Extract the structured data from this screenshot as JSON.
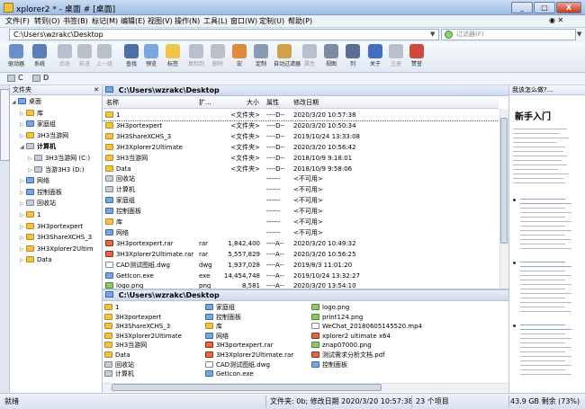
{
  "window": {
    "title": "xplorer2 * - 桌面 # [桌面]",
    "buttons": [
      "_",
      "□",
      "X"
    ]
  },
  "menu": [
    "文件(F)",
    "转到(O)",
    "书签(B)",
    "标记(M)",
    "编辑(E)",
    "视图(V)",
    "操作(N)",
    "工具(L)",
    "窗口(W)",
    "定制(U)",
    "帮助(P)"
  ],
  "menu_right": "◉  ✕",
  "address": {
    "value": "C:\\Users\\wzrakc\\Desktop",
    "filter_placeholder": "过滤器(F)"
  },
  "toolbar": [
    {
      "label": "驱动器",
      "icon": "drive-icon",
      "color": "#6b8fc9"
    },
    {
      "label": "系统",
      "icon": "system-icon",
      "color": "#5b7fb8"
    },
    {
      "label": "后退",
      "icon": "back-icon",
      "color": "#b8c0cc",
      "disabled": true
    },
    {
      "label": "前进",
      "icon": "forward-icon",
      "color": "#b8c0cc",
      "disabled": true
    },
    {
      "label": "上一级",
      "icon": "up-icon",
      "color": "#b8c0cc",
      "disabled": true
    },
    {
      "label": "查找",
      "icon": "binoculars-icon",
      "color": "#4d6fa8"
    },
    {
      "label": "预览",
      "icon": "preview-icon",
      "color": "#7aa7df"
    },
    {
      "label": "标签",
      "icon": "tab-icon",
      "color": "#f0c44a"
    },
    {
      "label": "复制到",
      "icon": "copy-icon",
      "color": "#b8c0cc",
      "disabled": true
    },
    {
      "label": "删除",
      "icon": "delete-icon",
      "color": "#b8c0cc",
      "disabled": true
    },
    {
      "label": "宏",
      "icon": "macro-icon",
      "color": "#e08a3c"
    },
    {
      "label": "定制",
      "icon": "customize-icon",
      "color": "#8a9ab0"
    },
    {
      "label": "自动过滤器",
      "icon": "filter-icon",
      "color": "#d2a24a"
    },
    {
      "label": "属性",
      "icon": "properties-icon",
      "color": "#b8c0cc",
      "disabled": true
    },
    {
      "label": "视图",
      "icon": "view-icon",
      "color": "#7a8aa0"
    },
    {
      "label": "列",
      "icon": "columns-icon",
      "color": "#5b6f94"
    },
    {
      "label": "关于",
      "icon": "help-icon",
      "color": "#3f6fc0"
    },
    {
      "label": "注册",
      "icon": "register-icon",
      "color": "#b8c0cc",
      "disabled": true
    },
    {
      "label": "赞誉",
      "icon": "praise-icon",
      "color": "#d04a3a"
    }
  ],
  "drives": [
    "C",
    "D"
  ],
  "tree": {
    "header": "文件夹",
    "items": [
      {
        "label": "桌面",
        "level": 0,
        "icon": "blue"
      },
      {
        "label": "库",
        "level": 1,
        "icon": "yellow"
      },
      {
        "label": "家庭组",
        "level": 1,
        "icon": "blue"
      },
      {
        "label": "3H3当游网",
        "level": 1,
        "icon": "yellow"
      },
      {
        "label": "计算机",
        "level": 1,
        "icon": "gray",
        "bold": true
      },
      {
        "label": "3H3当游网 (C:)",
        "level": 2,
        "icon": "gray"
      },
      {
        "label": "当游3H3 (D:)",
        "level": 2,
        "icon": "gray"
      },
      {
        "label": "网络",
        "level": 1,
        "icon": "blue"
      },
      {
        "label": "控制面板",
        "level": 1,
        "icon": "blue"
      },
      {
        "label": "回收站",
        "level": 1,
        "icon": "gray"
      },
      {
        "label": "1",
        "level": 1,
        "icon": "yellow"
      },
      {
        "label": "3H3portexpert",
        "level": 1,
        "icon": "yellow"
      },
      {
        "label": "3H3ShareXCHS_3",
        "level": 1,
        "icon": "yellow"
      },
      {
        "label": "3H3Xplorer2Ultim",
        "level": 1,
        "icon": "yellow"
      },
      {
        "label": "Data",
        "level": 1,
        "icon": "yellow"
      }
    ]
  },
  "pane1": {
    "path": "C:\\Users\\wzrakc\\Desktop",
    "columns": [
      "名称",
      "扩...",
      "大小",
      "属性",
      "修改日期"
    ],
    "rows": [
      {
        "name": "1",
        "ext": "",
        "size": "<文件夹>",
        "attr": "----D--",
        "date": "2020/3/20 10:57:38",
        "icon": "yellow",
        "selected": true
      },
      {
        "name": "3H3portexpert",
        "ext": "",
        "size": "<文件夹>",
        "attr": "----D--",
        "date": "2020/3/20 10:50:34",
        "icon": "yellow"
      },
      {
        "name": "3H3ShareXCHS_3",
        "ext": "",
        "size": "<文件夹>",
        "attr": "----D--",
        "date": "2019/10/24 13:33:08",
        "icon": "yellow"
      },
      {
        "name": "3H3Xplorer2Ultimate",
        "ext": "",
        "size": "<文件夹>",
        "attr": "----D--",
        "date": "2020/3/20 10:56:42",
        "icon": "yellow"
      },
      {
        "name": "3H3当游网",
        "ext": "",
        "size": "<文件夹>",
        "attr": "----D--",
        "date": "2018/10/9 9:18:01",
        "icon": "yellow"
      },
      {
        "name": "Data",
        "ext": "",
        "size": "<文件夹>",
        "attr": "----D--",
        "date": "2018/10/9 9:58:06",
        "icon": "yellow"
      },
      {
        "name": "回收站",
        "ext": "",
        "size": "",
        "attr": "------",
        "date": "<不可用>",
        "icon": "gray"
      },
      {
        "name": "计算机",
        "ext": "",
        "size": "",
        "attr": "------",
        "date": "<不可用>",
        "icon": "gray"
      },
      {
        "name": "家庭组",
        "ext": "",
        "size": "",
        "attr": "------",
        "date": "<不可用>",
        "icon": "blue"
      },
      {
        "name": "控制面板",
        "ext": "",
        "size": "",
        "attr": "------",
        "date": "<不可用>",
        "icon": "blue"
      },
      {
        "name": "库",
        "ext": "",
        "size": "",
        "attr": "------",
        "date": "<不可用>",
        "icon": "yellow"
      },
      {
        "name": "网络",
        "ext": "",
        "size": "",
        "attr": "------",
        "date": "<不可用>",
        "icon": "blue"
      },
      {
        "name": "3H3portexpert.rar",
        "ext": "rar",
        "size": "1,842,400",
        "attr": "----A--",
        "date": "2020/3/20 10:49:32",
        "icon": "red"
      },
      {
        "name": "3H3Xplorer2Ultimate.rar",
        "ext": "rar",
        "size": "5,557,829",
        "attr": "----A--",
        "date": "2020/3/20 10:56:25",
        "icon": "red"
      },
      {
        "name": "CAD测试图纸.dwg",
        "ext": "dwg",
        "size": "1,937,028",
        "attr": "----A--",
        "date": "2019/8/3 11:01:20",
        "icon": "white"
      },
      {
        "name": "GetIcon.exe",
        "ext": "exe",
        "size": "14,454,748",
        "attr": "----A--",
        "date": "2019/10/24 13:32:27",
        "icon": "blue"
      },
      {
        "name": "logo.png",
        "ext": "png",
        "size": "8,581",
        "attr": "----A--",
        "date": "2020/3/20 13:54:10",
        "icon": "green"
      }
    ]
  },
  "pane2": {
    "path": "C:\\Users\\wzrakc\\Desktop",
    "col1": [
      {
        "name": "1",
        "icon": "yellow"
      },
      {
        "name": "3H3portexpert",
        "icon": "yellow"
      },
      {
        "name": "3H3ShareXCHS_3",
        "icon": "yellow"
      },
      {
        "name": "3H3Xplorer2Ultimate",
        "icon": "yellow"
      },
      {
        "name": "3H3当游网",
        "icon": "yellow"
      },
      {
        "name": "Data",
        "icon": "yellow"
      },
      {
        "name": "回收站",
        "icon": "gray"
      },
      {
        "name": "计算机",
        "icon": "gray"
      }
    ],
    "col2": [
      {
        "name": "家庭组",
        "icon": "blue"
      },
      {
        "name": "控制面板",
        "icon": "blue"
      },
      {
        "name": "库",
        "icon": "yellow"
      },
      {
        "name": "网络",
        "icon": "blue"
      },
      {
        "name": "3H3portexpert.rar",
        "icon": "red"
      },
      {
        "name": "3H3Xplorer2Ultimate.rar",
        "icon": "red"
      },
      {
        "name": "CAD测试图纸.dwg",
        "icon": "white"
      },
      {
        "name": "GetIcon.exe",
        "icon": "blue"
      }
    ],
    "col3": [
      {
        "name": "logo.png",
        "icon": "green"
      },
      {
        "name": "print124.png",
        "icon": "green"
      },
      {
        "name": "WeChat_20180605145520.mp4",
        "icon": "white"
      },
      {
        "name": "xplorer2 ultimate x64",
        "icon": "red"
      },
      {
        "name": "znap07000.png",
        "icon": "green"
      },
      {
        "name": "测试需求分析文档.pdf",
        "icon": "red"
      },
      {
        "name": "控制面板",
        "icon": "blue"
      }
    ]
  },
  "help": {
    "header": "我该怎么做?...",
    "title": "新手入门"
  },
  "status": {
    "left": "就绪",
    "info": "文件夹: 0b; 修改日期 2020/3/20 10:57:38",
    "count": "23 个项目",
    "disk": "43.9 GB 剩余 (73%)"
  }
}
